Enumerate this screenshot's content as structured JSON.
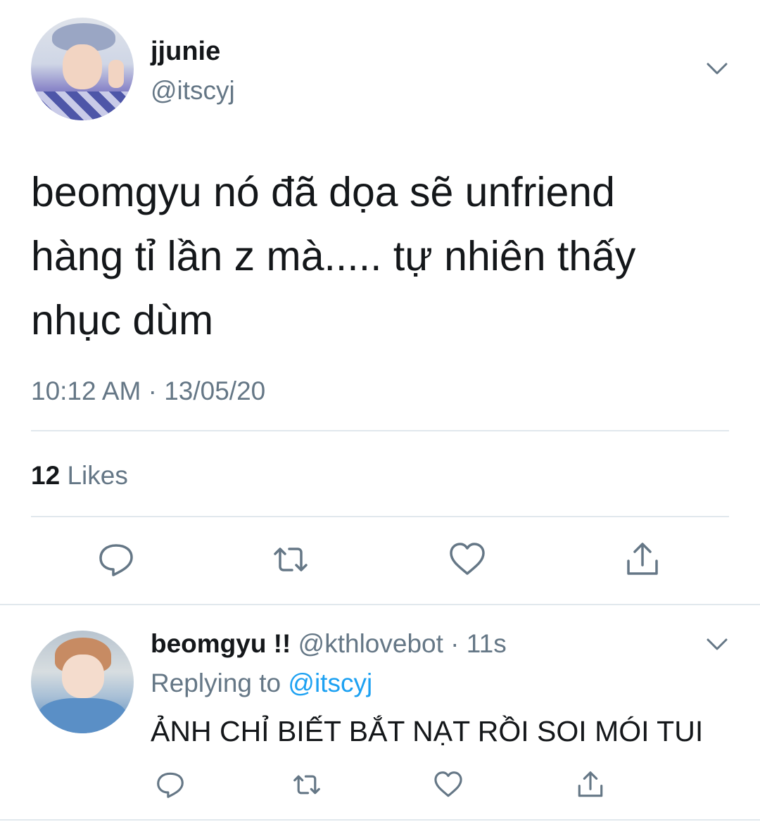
{
  "main_tweet": {
    "display_name": "jjunie",
    "handle": "@itscyj",
    "text_lines": [
      "beomgyu nó đã dọa sẽ unfriend",
      "hàng tỉ lần z mà..... tự nhiên thấy",
      "nhục dùm"
    ],
    "timestamp": "10:12 AM · 13/05/20",
    "likes_count": "12",
    "likes_label": "Likes",
    "icons": {
      "menu": "chevron-down-icon",
      "reply": "reply-bubble-icon",
      "retweet": "retweet-icon",
      "like": "heart-icon",
      "share": "share-icon"
    }
  },
  "reply_tweet": {
    "display_name": "beomgyu !!",
    "meta": "@kthlovebot · 11s",
    "replying_label": "Replying to",
    "replying_handle": "@itscyj",
    "text": "ẢNH CHỈ BIẾT BẮT NẠT RỒI SOI MÓI TUI"
  },
  "colors": {
    "text": "#14171a",
    "secondary": "#657786",
    "link": "#1da1f2",
    "divider": "#e1e8ed"
  }
}
